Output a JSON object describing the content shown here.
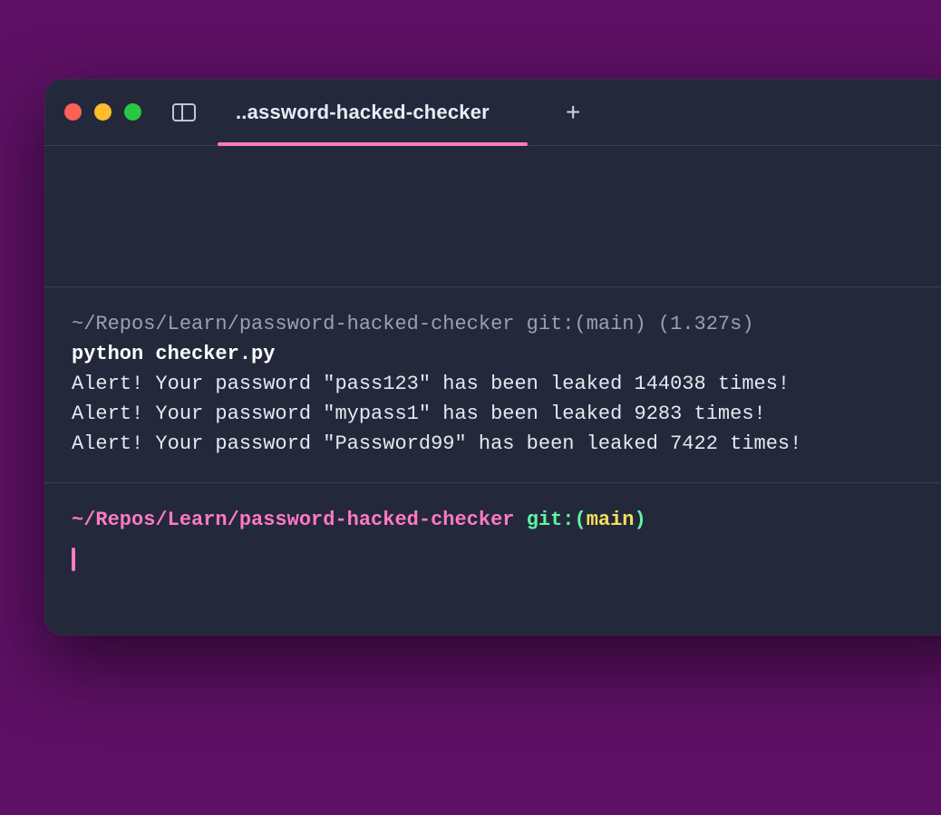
{
  "titlebar": {
    "tab_title": "..assword-hacked-checker",
    "new_tab_glyph": "+"
  },
  "block1": {
    "prompt_line": "~/Repos/Learn/password-hacked-checker git:(main) (1.327s)",
    "command": "python checker.py",
    "output": [
      "Alert! Your password \"pass123\" has been leaked 144038 times!",
      "Alert! Your password \"mypass1\" has been leaked 9283 times!",
      "Alert! Your password \"Password99\" has been leaked 7422 times!"
    ]
  },
  "block2": {
    "path": "~/Repos/Learn/password-hacked-checker",
    "git_label": "git:",
    "branch": "main"
  },
  "colors": {
    "bg_page": "#5d1064",
    "bg_window": "#24283b",
    "accent_pink": "#ff79c6",
    "accent_green": "#5ff3a3",
    "accent_yellow": "#f1e05a",
    "text_dim": "#9aa0b5",
    "text_bright": "#ffffff"
  }
}
